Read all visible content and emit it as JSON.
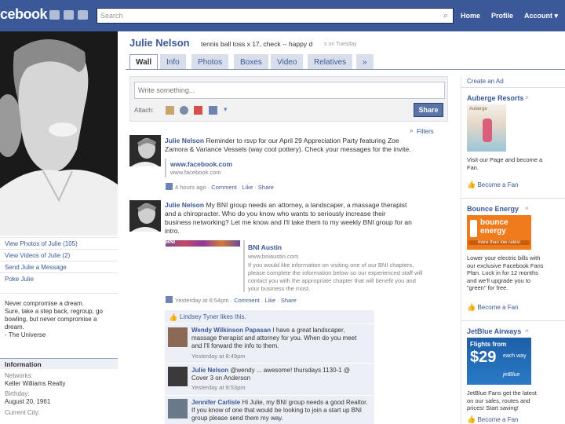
{
  "header": {
    "logo": "cebook",
    "search_placeholder": "Search",
    "nav": [
      "Home",
      "Profile",
      "Account ▾"
    ]
  },
  "profile": {
    "name": "Julie Nelson",
    "status": "tennis ball toss x 17, check -- happy d",
    "status_time": "s on Tuesday"
  },
  "tabs": [
    "Wall",
    "Info",
    "Photos",
    "Boxes",
    "Video",
    "Relatives",
    "»"
  ],
  "publisher": {
    "placeholder": "Write something...",
    "attach_label": "Attach:",
    "share_label": "Share",
    "filters_label": "Filters"
  },
  "left": {
    "links": [
      "View Photos of Julie (105)",
      "View Videos of Julie (2)",
      "Send Julie a Message",
      "Poke Julie"
    ],
    "quote": [
      "Never compromise a dream.",
      "Sure, take a step back, regroup, go",
      "bowling, but never compromise a",
      "dream.",
      "- The Universe"
    ],
    "info_header": "Information",
    "info": [
      {
        "label": "Networks:",
        "value": "Keller Williams Realty"
      },
      {
        "label": "Birthday:",
        "value": "August 20, 1961"
      },
      {
        "label": "Current City:",
        "value": ""
      }
    ]
  },
  "stories": [
    {
      "author": "Julie Nelson",
      "lines": [
        "Reminder to rsvp for our April 29 Appreciation Party featuring Zoe",
        "Zamora & Variance Vessels (way cool pottery). Check your messages for the invite."
      ],
      "attach_title": "www.facebook.com",
      "attach_sub": "www.facebook.com",
      "meta": {
        "time": "4 hours ago",
        "comment": "Comment",
        "like": "Like",
        "share": "Share"
      }
    },
    {
      "author": "Julie Nelson",
      "lines": [
        "My BNI group needs an attorney, a landscaper, a massage therapist",
        "and a chiropracter. Who do you know who wants to seriously increase their",
        "business networking? Let me know and I'll take them to my weekly BNI group for an",
        "intro."
      ],
      "bni_label": "BNI",
      "attach_title": "BNI Austin",
      "attach_sub": "www.bniaustin.com",
      "attach_desc": [
        "If you would like information on visiting one of our BNI chapters,",
        "please complete the information below so our experienced staff will",
        "contact you with the appropriate chapter that will benefit you and",
        "your business the most."
      ],
      "meta": {
        "time": "Yesterday at 6:54pm",
        "comment": "Comment",
        "like": "Like",
        "share": "Share"
      },
      "likes": "Lindsey Tyner likes this.",
      "comments": [
        {
          "author": "Wendy Wilkinson Papasan",
          "text": [
            "I have a great landscaper,",
            "massage therapist and attorney for you. When do you meet",
            "and I'll forward the info to them."
          ],
          "time": "Yesterday at 8:49pm"
        },
        {
          "author": "Julie Nelson",
          "text": [
            "@wendy ... awesome! thursdays 1130-1 @",
            "Cover 3 on Anderson"
          ],
          "time": "Yesterday at 9:53pm"
        },
        {
          "author": "Jennifer Carlisle",
          "text": [
            "Hi Julie, my BNI group needs a good Realtor.",
            "If you know of one that would be looking to join a start up BNI",
            "group please send them my way."
          ],
          "time": ""
        }
      ]
    }
  ],
  "ads": {
    "create_ad": "Create an Ad",
    "close": "×",
    "items": [
      {
        "title": "Auberge Resorts",
        "image_caption": "Auberge",
        "body": [
          "Visit our Page and become a",
          "Fan."
        ],
        "fan": "Become a Fan"
      },
      {
        "title": "Bounce Energy",
        "image_caption": [
          "bounce",
          "energy",
          "more than low rates!"
        ],
        "body": [
          "Lower your electric bills with",
          "our exclusive Facebook Fans",
          "Plan. Lock in for 12 months",
          "and we'll upgrade you to",
          "\"green\" for free."
        ],
        "fan": "Become a Fan"
      },
      {
        "title": "JetBlue Airways",
        "image_caption": [
          "Flights from",
          "$29",
          "each way",
          "jetBlue"
        ],
        "body": [
          "JetBlue Fans get the latest",
          "on our sales, routes and",
          "prices! Start saving!"
        ],
        "fan": "Become a Fan"
      }
    ]
  },
  "colors": {
    "brand": "#3b5998",
    "tab_bg": "#d8dfea",
    "comment_bg": "#eceff5",
    "bounce_orange": "#f07b1c",
    "jetblue": "#1e5fa8"
  }
}
